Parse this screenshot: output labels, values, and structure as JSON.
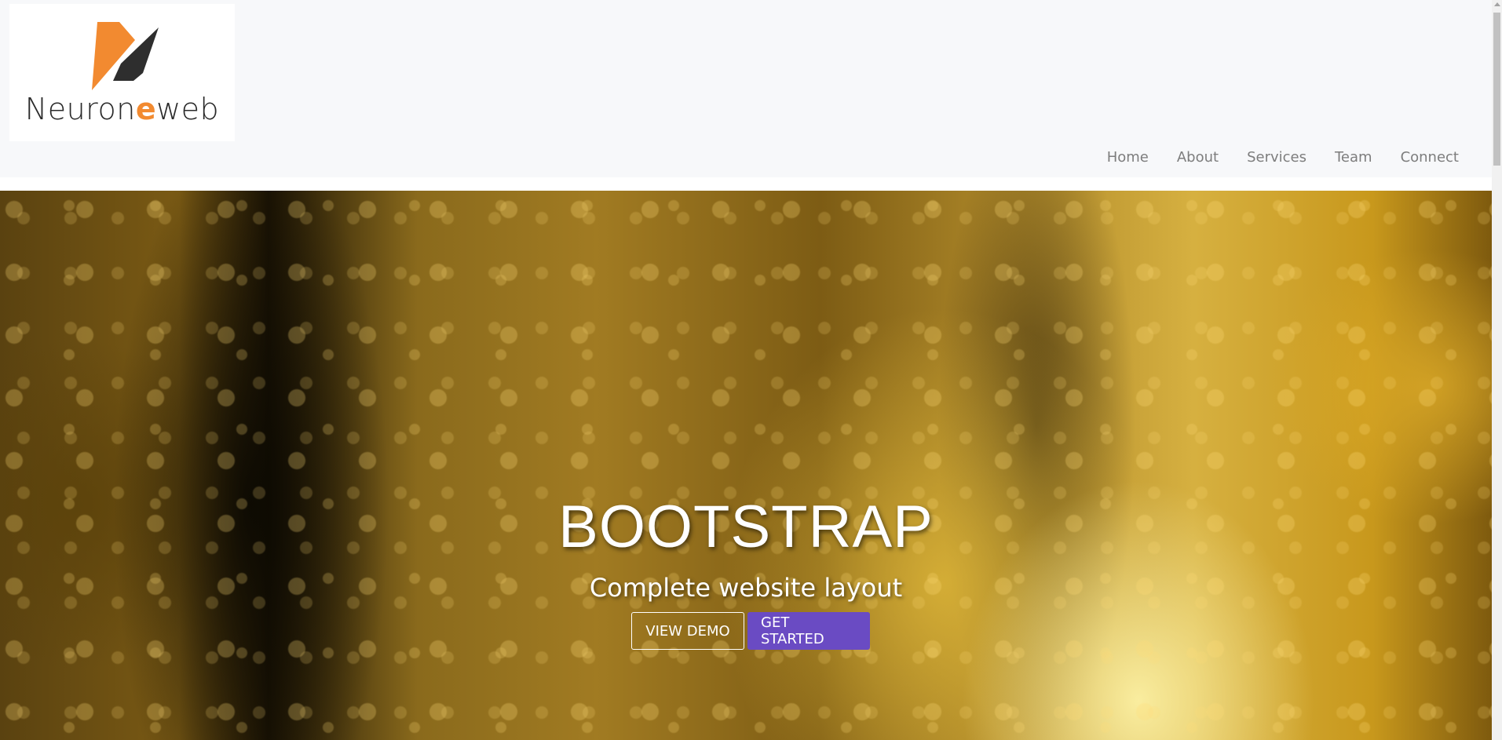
{
  "brand": {
    "name_prefix": "Neuron",
    "name_accent": "e",
    "name_suffix": "web",
    "logo_icon": "neuroneweb-logo-icon",
    "accent_color": "#f28a30"
  },
  "nav": {
    "items": [
      {
        "label": "Home"
      },
      {
        "label": "About"
      },
      {
        "label": "Services"
      },
      {
        "label": "Team"
      },
      {
        "label": "Connect"
      }
    ]
  },
  "hero": {
    "title": "BOOTSTRAP",
    "subtitle": "Complete website layout",
    "view_demo_label": "VIEW DEMO",
    "get_started_label": "GET STARTED",
    "primary_color": "#6a4bc3"
  }
}
